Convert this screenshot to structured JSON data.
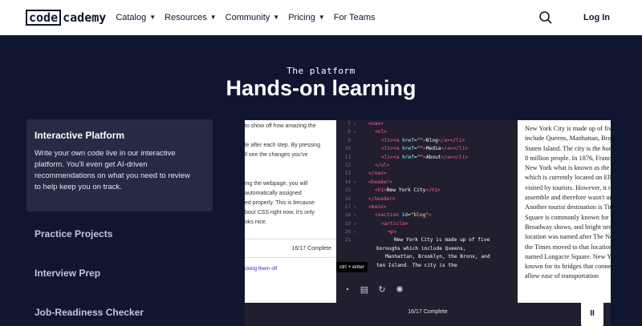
{
  "header": {
    "logo_box": "code",
    "logo_rest": "cademy",
    "nav": [
      {
        "label": "Catalog",
        "caret": true
      },
      {
        "label": "Resources",
        "caret": true
      },
      {
        "label": "Community",
        "caret": true
      },
      {
        "label": "Pricing",
        "caret": true
      },
      {
        "label": "For Teams",
        "caret": false
      }
    ],
    "login_label": "Log In"
  },
  "hero": {
    "eyebrow": "The platform",
    "title": "Hands-on learning"
  },
  "tabs": {
    "active": {
      "title": "Interactive Platform",
      "description_lines": [
        "Write your own code live in our interactive",
        "platform. You'll even get AI-driven",
        "recommendations on what you need to review",
        "to help keep you on track."
      ]
    },
    "others": [
      "Practice Projects",
      "Interview Prep",
      "Job-Readiness Checker"
    ]
  },
  "demo": {
    "lesson_lines": [
      "to show off how amazing the",
      "",
      "le after each step. By pressing",
      "ll see the changes you've",
      "",
      "",
      "ing the webpage, you will",
      "automatically assigned",
      "ed properly. This is because",
      "bout CSS right now, it's only",
      "oks nice."
    ],
    "lesson_progress": "16/17 Complete",
    "lesson_link": "cking them off",
    "code_lines": [
      {
        "n": "7",
        "fold": "▾",
        "indent": 1,
        "parts": [
          [
            "tg",
            "<nav>"
          ]
        ]
      },
      {
        "n": "8",
        "fold": "▾",
        "indent": 2,
        "parts": [
          [
            "tg",
            "<ul>"
          ]
        ]
      },
      {
        "n": "9",
        "fold": "",
        "indent": 3,
        "parts": [
          [
            "tg",
            "<li><a "
          ],
          [
            "at",
            "href"
          ],
          [
            "tx",
            "="
          ],
          [
            "st",
            "\"\""
          ],
          [
            "tg",
            ">"
          ],
          [
            "tx",
            "Blog"
          ],
          [
            "tg",
            "</a></li>"
          ]
        ]
      },
      {
        "n": "10",
        "fold": "",
        "indent": 3,
        "parts": [
          [
            "tg",
            "<li><a "
          ],
          [
            "at",
            "href"
          ],
          [
            "tx",
            "="
          ],
          [
            "st",
            "\"\""
          ],
          [
            "tg",
            ">"
          ],
          [
            "tx",
            "Media"
          ],
          [
            "tg",
            "</a></li>"
          ]
        ]
      },
      {
        "n": "11",
        "fold": "",
        "indent": 3,
        "parts": [
          [
            "tg",
            "<li><a "
          ],
          [
            "at",
            "href"
          ],
          [
            "tx",
            "="
          ],
          [
            "st",
            "\"\""
          ],
          [
            "tg",
            ">"
          ],
          [
            "tx",
            "About"
          ],
          [
            "tg",
            "</a></li>"
          ]
        ]
      },
      {
        "n": "12",
        "fold": "",
        "indent": 2,
        "parts": [
          [
            "tg",
            "</ul>"
          ]
        ]
      },
      {
        "n": "13",
        "fold": "",
        "indent": 1,
        "parts": [
          [
            "tg",
            "</nav>"
          ]
        ]
      },
      {
        "n": "14",
        "fold": "▾",
        "indent": 1,
        "parts": [
          [
            "tg",
            "<header>"
          ]
        ]
      },
      {
        "n": "15",
        "fold": "",
        "indent": 2,
        "parts": [
          [
            "tg",
            "<h1>"
          ],
          [
            "tx",
            "New York City"
          ],
          [
            "tg",
            "</h1>"
          ]
        ]
      },
      {
        "n": "16",
        "fold": "",
        "indent": 1,
        "parts": [
          [
            "tg",
            "</header>"
          ]
        ]
      },
      {
        "n": "17",
        "fold": "▾",
        "indent": 1,
        "parts": [
          [
            "tg",
            "<main>"
          ]
        ]
      },
      {
        "n": "18",
        "fold": "▾",
        "indent": 2,
        "parts": [
          [
            "tg",
            "<section "
          ],
          [
            "at",
            "id"
          ],
          [
            "tx",
            "="
          ],
          [
            "st",
            "\"blog\""
          ],
          [
            "tg",
            ">"
          ]
        ]
      },
      {
        "n": "19",
        "fold": "▾",
        "indent": 3,
        "parts": [
          [
            "tg",
            "<article>"
          ]
        ]
      },
      {
        "n": "20",
        "fold": "▾",
        "indent": 4,
        "parts": [
          [
            "tg",
            "<p>"
          ]
        ]
      },
      {
        "n": "21",
        "fold": "",
        "indent": 5,
        "parts": [
          [
            "tx",
            "New York City is made up of five"
          ]
        ]
      }
    ],
    "wrap_lines": [
      "boroughs which include Queens,",
      "   Manhattan, Brooklyn, the Bronx, and",
      "ten Island. The city is the"
    ],
    "tooltip": "ctrl + enter",
    "tool_icons": [
      "◔",
      "▤",
      "↻",
      "✺"
    ],
    "browser_lines": [
      "New York City is made up of five",
      "include Queens, Manhattan, Broo",
      "Staten Island. The city is the hom",
      "8 million people. In 1876, France",
      "New York what is known as the S",
      "which is currently located on Elli",
      "visited by tourists. However, it to",
      "assemble and therefore wasn't un",
      "Another tourist destination is Tim",
      "Square is commonly known for th",
      "Broadway shows, and bright neon",
      "location was named after The Ne",
      "the Times moved to that location",
      "named Longacre Square. New Yo",
      "known for its bridges that connec",
      "allow ease of transportation"
    ],
    "bottom_progress": "16/17 Complete",
    "pause_label": "II"
  }
}
